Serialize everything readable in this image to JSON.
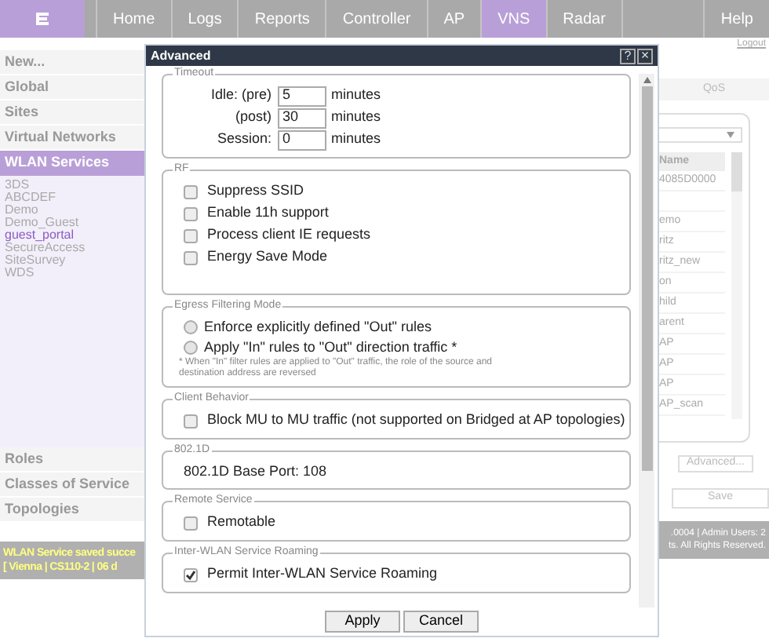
{
  "nav": {
    "tabs": [
      {
        "label": "Home",
        "selected": false
      },
      {
        "label": "Logs",
        "selected": false
      },
      {
        "label": "Reports",
        "selected": false
      },
      {
        "label": "Controller",
        "selected": false
      },
      {
        "label": "AP",
        "selected": false
      },
      {
        "label": "VNS",
        "selected": true
      },
      {
        "label": "Radar",
        "selected": false
      }
    ],
    "help": "Help",
    "logout": "Logout"
  },
  "sidebar": {
    "top": [
      "New...",
      "Global",
      "Sites",
      "Virtual Networks"
    ],
    "header": "WLAN Services",
    "items": [
      {
        "label": "3DS",
        "selected": false
      },
      {
        "label": "ABCDEF",
        "selected": false
      },
      {
        "label": "Demo",
        "selected": false
      },
      {
        "label": "Demo_Guest",
        "selected": false
      },
      {
        "label": "guest_portal",
        "selected": true
      },
      {
        "label": "SecureAccess",
        "selected": false
      },
      {
        "label": "SiteSurvey",
        "selected": false
      },
      {
        "label": "WDS",
        "selected": false
      }
    ],
    "bottom": [
      "Roles",
      "Classes of Service",
      "Topologies"
    ]
  },
  "status_bar": {
    "left": [
      "WLAN Service saved succe",
      "[ Vienna | CS110-2 | 06 d"
    ],
    "right": [
      ".0004 | Admin Users: 2",
      "ts. All Rights Reserved."
    ]
  },
  "right_panel": {
    "tab": "QoS",
    "column": "Name",
    "rows": [
      "4085D0000",
      "",
      "emo",
      "ritz",
      "ritz_new",
      "on",
      "hild",
      "arent",
      "AP",
      "AP",
      "AP",
      "AP_scan"
    ],
    "advanced_button": "Advanced...",
    "save_button": "Save"
  },
  "dialog": {
    "title": "Advanced",
    "help": "?",
    "close": "×",
    "sections": [
      {
        "title": "Timeout",
        "rows": [
          {
            "kind": "timeout",
            "label": "Idle: (pre)",
            "value": "5",
            "unit": "minutes"
          },
          {
            "kind": "timeout",
            "label": "(post)",
            "value": "30",
            "unit": "minutes"
          },
          {
            "kind": "timeout",
            "label": "Session:",
            "value": "0",
            "unit": "minutes"
          }
        ]
      },
      {
        "title": "RF",
        "rows": [
          {
            "kind": "checkbox",
            "label": "Suppress SSID",
            "checked": false
          },
          {
            "kind": "checkbox",
            "label": "Enable 11h support",
            "checked": false
          },
          {
            "kind": "checkbox",
            "label": "Process client IE requests",
            "checked": false
          },
          {
            "kind": "checkbox",
            "label": "Energy Save Mode",
            "checked": false
          }
        ]
      },
      {
        "title": "Egress Filtering Mode",
        "rows": [
          {
            "kind": "radio",
            "label": "Enforce explicitly defined \"Out\" rules",
            "selected": false
          },
          {
            "kind": "radio",
            "label": "Apply \"In\" rules to \"Out\" direction traffic *",
            "selected": false
          },
          {
            "kind": "note",
            "label": "* When \"In\" filter rules are applied to \"Out\" traffic, the role of the source and destination address are reversed"
          }
        ]
      },
      {
        "title": "Client Behavior",
        "rows": [
          {
            "kind": "checkbox",
            "label": "Block MU to MU traffic (not supported on Bridged at AP topologies)",
            "checked": false
          }
        ]
      },
      {
        "title": "802.1D",
        "rows": [
          {
            "kind": "text",
            "label": "802.1D Base Port: 108"
          }
        ]
      },
      {
        "title": "Remote Service",
        "rows": [
          {
            "kind": "checkbox",
            "label": "Remotable",
            "checked": false
          }
        ]
      },
      {
        "title": "Inter-WLAN Service Roaming",
        "rows": [
          {
            "kind": "checkbox",
            "label": "Permit Inter-WLAN Service Roaming",
            "checked": true
          }
        ]
      }
    ],
    "buttons": [
      "Apply",
      "Cancel"
    ]
  }
}
